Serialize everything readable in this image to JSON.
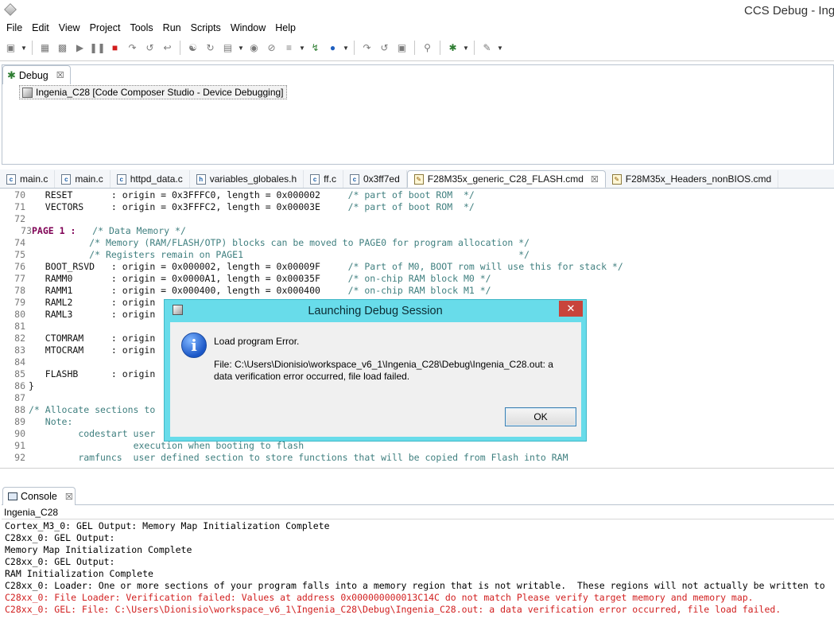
{
  "window": {
    "title": "CCS Debug - Inge"
  },
  "menubar": {
    "items": [
      "File",
      "Edit",
      "View",
      "Project",
      "Tools",
      "Run",
      "Scripts",
      "Window",
      "Help"
    ]
  },
  "toolbar": {
    "icons": [
      "new-icon",
      "save-icon",
      "save-all-icon",
      "resume-icon",
      "suspend-icon",
      "terminate-icon",
      "step-into-icon",
      "step-over-icon",
      "step-return-icon",
      "reset-icon",
      "restart-icon",
      "memory-icon",
      "breakpoint-icon",
      "skip-breakpoints-icon",
      "connect-icon",
      "load-icon",
      "build-icon",
      "step-asm-icon",
      "step-over-asm-icon",
      "view-icon",
      "search-icon",
      "debug-icon",
      "external-tools-icon"
    ]
  },
  "debug_view": {
    "tab_label": "Debug",
    "tree_item": "Ingenia_C28 [Code Composer Studio - Device Debugging]"
  },
  "editor": {
    "tabs": [
      {
        "label": "main.c",
        "icon": "c-file-icon",
        "kind": "c"
      },
      {
        "label": "main.c",
        "icon": "c-file-icon",
        "kind": "c"
      },
      {
        "label": "httpd_data.c",
        "icon": "c-file-icon",
        "kind": "c"
      },
      {
        "label": "variables_globales.h",
        "icon": "h-file-icon",
        "kind": "h"
      },
      {
        "label": "ff.c",
        "icon": "c-file-icon",
        "kind": "c"
      },
      {
        "label": "0x3ff7ed",
        "icon": "c-file-icon",
        "kind": "c"
      },
      {
        "label": "F28M35x_generic_C28_FLASH.cmd",
        "icon": "cmd-file-icon",
        "kind": "cmd",
        "active": true
      },
      {
        "label": "F28M35x_Headers_nonBIOS.cmd",
        "icon": "cmd-file-icon",
        "kind": "cmd"
      }
    ],
    "lines": [
      {
        "n": "70",
        "code": "   RESET       : origin = 0x3FFFC0, length = 0x000002     ",
        "comment": "/* part of boot ROM  */"
      },
      {
        "n": "71",
        "code": "   VECTORS     : origin = 0x3FFFC2, length = 0x00003E     ",
        "comment": "/* part of boot ROM  */"
      },
      {
        "n": "72",
        "code": "",
        "comment": ""
      },
      {
        "n": "73",
        "kw": "PAGE 1 :",
        "code": "   ",
        "comment": "/* Data Memory */"
      },
      {
        "n": "74",
        "code": "           ",
        "comment": "/* Memory (RAM/FLASH/OTP) blocks can be moved to PAGE0 for program allocation */"
      },
      {
        "n": "75",
        "code": "           ",
        "comment": "/* Registers remain on PAGE1                                                  */"
      },
      {
        "n": "76",
        "code": "   BOOT_RSVD   : origin = 0x000002, length = 0x00009F     ",
        "comment": "/* Part of M0, BOOT rom will use this for stack */"
      },
      {
        "n": "77",
        "code": "   RAMM0       : origin = 0x0000A1, length = 0x00035F     ",
        "comment": "/* on-chip RAM block M0 */"
      },
      {
        "n": "78",
        "code": "   RAMM1       : origin = 0x000400, length = 0x000400     ",
        "comment": "/* on-chip RAM block M1 */"
      },
      {
        "n": "79",
        "code": "   RAML2       : origin",
        "comment": ""
      },
      {
        "n": "80",
        "code": "   RAML3       : origin",
        "comment": ""
      },
      {
        "n": "81",
        "code": "",
        "comment": ""
      },
      {
        "n": "82",
        "code": "   CTOMRAM     : origin",
        "comment": ""
      },
      {
        "n": "83",
        "code": "   MTOCRAM     : origin",
        "comment": ""
      },
      {
        "n": "84",
        "code": "",
        "comment": ""
      },
      {
        "n": "85",
        "code": "   FLASHB      : origin",
        "comment": ""
      },
      {
        "n": "86",
        "code": "}",
        "comment": ""
      },
      {
        "n": "87",
        "code": "",
        "comment": ""
      },
      {
        "n": "88",
        "code": "",
        "comment": "/* Allocate sections to"
      },
      {
        "n": "89",
        "code": "   ",
        "comment": "Note:"
      },
      {
        "n": "90",
        "code": "         ",
        "comment": "codestart user"
      },
      {
        "n": "91",
        "code": "                   ",
        "comment": "execution when booting to flash"
      },
      {
        "n": "92",
        "code": "         ",
        "comment": "ramfuncs  user defined section to store functions that will be copied from Flash into RAM"
      }
    ]
  },
  "console": {
    "tab_label": "Console",
    "title": "Ingenia_C28",
    "lines": [
      {
        "text": "Cortex_M3_0: GEL Output: Memory Map Initialization Complete",
        "error": false
      },
      {
        "text": "C28xx_0: GEL Output:",
        "error": false
      },
      {
        "text": "Memory Map Initialization Complete",
        "error": false
      },
      {
        "text": "C28xx_0: GEL Output:",
        "error": false
      },
      {
        "text": "RAM Initialization Complete",
        "error": false
      },
      {
        "text": "C28xx_0: Loader: One or more sections of your program falls into a memory region that is not writable.  These regions will not actually be written to",
        "error": false
      },
      {
        "text": "C28xx_0: File Loader: Verification failed: Values at address 0x000000000013C14C do not match Please verify target memory and memory map.",
        "error": true
      },
      {
        "text": "C28xx_0: GEL: File: C:\\Users\\Dionisio\\workspace_v6_1\\Ingenia_C28\\Debug\\Ingenia_C28.out: a data verification error occurred, file load failed.",
        "error": true
      }
    ]
  },
  "dialog": {
    "title": "Launching Debug Session",
    "close_label": "✕",
    "message": "Load program Error.",
    "detail": "File: C:\\Users\\Dionisio\\workspace_v6_1\\Ingenia_C28\\Debug\\Ingenia_C28.out: a data verification error occurred, file load failed.",
    "ok_label": "OK",
    "info_glyph": "i"
  },
  "colors": {
    "dialog_frame": "#68dcea",
    "error_text": "#d11f1f",
    "comment_text": "#3f7f7f",
    "keyword_text": "#7f0055"
  }
}
